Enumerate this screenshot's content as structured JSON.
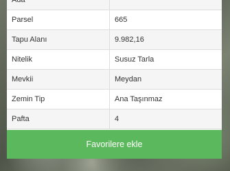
{
  "parcel_info": {
    "rows": [
      {
        "label": "Ada",
        "value": ""
      },
      {
        "label": "Parsel",
        "value": "665"
      },
      {
        "label": "Tapu Alanı",
        "value": "9.982,16"
      },
      {
        "label": "Nitelik",
        "value": "Susuz Tarla"
      },
      {
        "label": "Mevkii",
        "value": "Meydan"
      },
      {
        "label": "Zemin Tip",
        "value": "Ana Taşınmaz"
      },
      {
        "label": "Pafta",
        "value": "4"
      }
    ]
  },
  "actions": {
    "favorite_label": "Favorilere ekle"
  },
  "colors": {
    "button_bg": "#5cb85c",
    "row_stripe": "#f5f5f5"
  }
}
